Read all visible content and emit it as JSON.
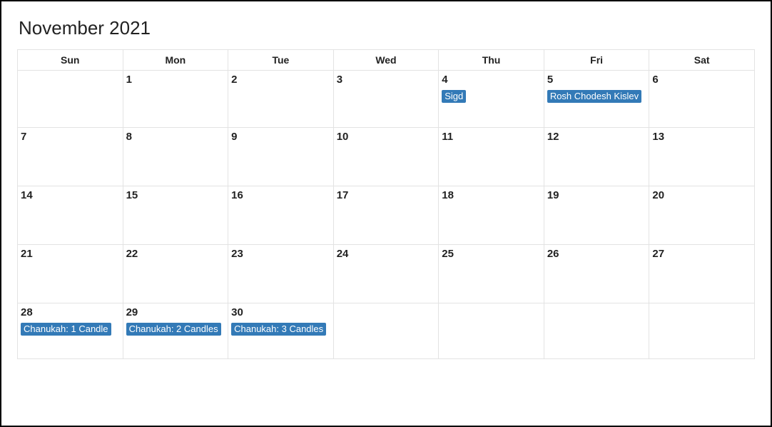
{
  "title": "November 2021",
  "weekday_headers": [
    "Sun",
    "Mon",
    "Tue",
    "Wed",
    "Thu",
    "Fri",
    "Sat"
  ],
  "weeks": [
    [
      {
        "day": "",
        "events": []
      },
      {
        "day": "1",
        "events": []
      },
      {
        "day": "2",
        "events": []
      },
      {
        "day": "3",
        "events": []
      },
      {
        "day": "4",
        "events": [
          "Sigd"
        ]
      },
      {
        "day": "5",
        "events": [
          "Rosh Chodesh Kislev"
        ]
      },
      {
        "day": "6",
        "events": []
      }
    ],
    [
      {
        "day": "7",
        "events": []
      },
      {
        "day": "8",
        "events": []
      },
      {
        "day": "9",
        "events": []
      },
      {
        "day": "10",
        "events": []
      },
      {
        "day": "11",
        "events": []
      },
      {
        "day": "12",
        "events": []
      },
      {
        "day": "13",
        "events": []
      }
    ],
    [
      {
        "day": "14",
        "events": []
      },
      {
        "day": "15",
        "events": []
      },
      {
        "day": "16",
        "events": []
      },
      {
        "day": "17",
        "events": []
      },
      {
        "day": "18",
        "events": []
      },
      {
        "day": "19",
        "events": []
      },
      {
        "day": "20",
        "events": []
      }
    ],
    [
      {
        "day": "21",
        "events": []
      },
      {
        "day": "22",
        "events": []
      },
      {
        "day": "23",
        "events": []
      },
      {
        "day": "24",
        "events": []
      },
      {
        "day": "25",
        "events": []
      },
      {
        "day": "26",
        "events": []
      },
      {
        "day": "27",
        "events": []
      }
    ],
    [
      {
        "day": "28",
        "events": [
          "Chanukah: 1 Candle"
        ]
      },
      {
        "day": "29",
        "events": [
          "Chanukah: 2 Candles"
        ]
      },
      {
        "day": "30",
        "events": [
          "Chanukah: 3 Candles"
        ]
      },
      {
        "day": "",
        "events": []
      },
      {
        "day": "",
        "events": []
      },
      {
        "day": "",
        "events": []
      },
      {
        "day": "",
        "events": []
      }
    ]
  ]
}
